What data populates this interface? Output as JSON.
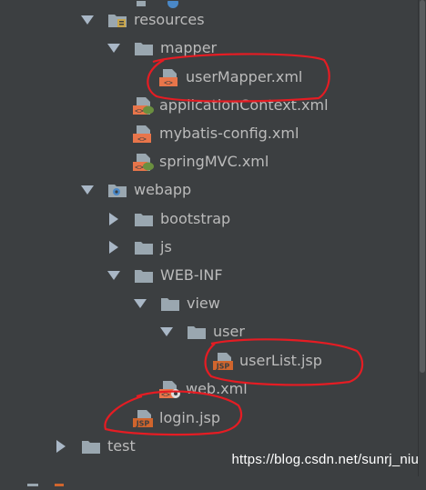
{
  "colors": {
    "background": "#3c3f41",
    "text": "#bbbbbb",
    "folder": "#9aa7b0",
    "xml_file": "#e8754a",
    "jsp_file": "#d0652d",
    "spring_leaf": "#6a8f3f",
    "annotation_red": "#e51c23"
  },
  "tree": {
    "resources": {
      "label": "resources",
      "icon": "resources-folder-icon",
      "expanded": true
    },
    "mapper": {
      "label": "mapper",
      "icon": "folder-icon",
      "expanded": true
    },
    "user_mapper_xml": {
      "label": "userMapper.xml",
      "icon": "xml-file-icon"
    },
    "application_context_xml": {
      "label": "applicationContext.xml",
      "icon": "spring-xml-file-icon"
    },
    "mybatis_config_xml": {
      "label": "mybatis-config.xml",
      "icon": "xml-file-icon"
    },
    "spring_mvc_xml": {
      "label": "springMVC.xml",
      "icon": "spring-xml-file-icon"
    },
    "webapp": {
      "label": "webapp",
      "icon": "web-folder-icon",
      "expanded": true
    },
    "bootstrap": {
      "label": "bootstrap",
      "icon": "folder-icon",
      "expanded": false
    },
    "js": {
      "label": "js",
      "icon": "folder-icon",
      "expanded": false
    },
    "web_inf": {
      "label": "WEB-INF",
      "icon": "folder-icon",
      "expanded": true
    },
    "view": {
      "label": "view",
      "icon": "folder-icon",
      "expanded": true
    },
    "user": {
      "label": "user",
      "icon": "folder-icon",
      "expanded": true
    },
    "user_list_jsp": {
      "label": "userList.jsp",
      "icon": "jsp-file-icon"
    },
    "web_xml": {
      "label": "web.xml",
      "icon": "web-xml-file-icon"
    },
    "login_jsp": {
      "label": "login.jsp",
      "icon": "jsp-file-icon"
    },
    "test": {
      "label": "test",
      "icon": "folder-icon",
      "expanded": false
    }
  },
  "icon_text": {
    "xml": "<>",
    "jsp": "JSP"
  },
  "watermark": "https://blog.csdn.net/sunrj_niu"
}
